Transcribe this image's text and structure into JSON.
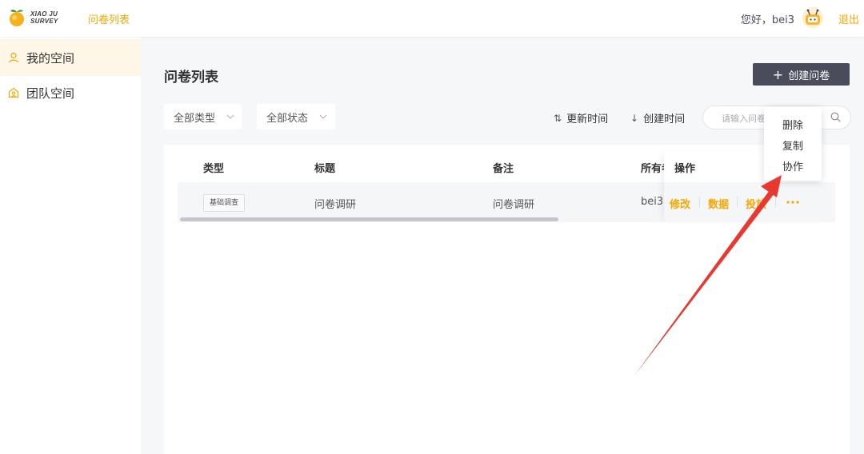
{
  "header": {
    "logo_line1": "XIAO JU",
    "logo_line2": "SURVEY",
    "nav_title": "问卷列表",
    "greeting": "您好，bei3",
    "logout": "退出"
  },
  "sidebar": {
    "items": [
      {
        "label": "我的空间",
        "icon": "user-icon",
        "active": true
      },
      {
        "label": "团队空间",
        "icon": "team-icon",
        "active": false
      }
    ]
  },
  "main": {
    "title": "问卷列表",
    "create_label": "创建问卷",
    "filters": {
      "type": "全部类型",
      "status": "全部状态"
    },
    "sorts": {
      "updated": "更新时间",
      "created": "创建时间"
    },
    "search": {
      "placeholder": "请输入问卷"
    },
    "table": {
      "headers": {
        "type": "类型",
        "title": "标题",
        "remark": "备注",
        "owner": "所有者",
        "actions": "操作"
      },
      "rows": [
        {
          "type": "基础调查",
          "title": "问卷调研",
          "remark": "问卷调研",
          "owner": "bei3"
        }
      ],
      "actions": {
        "edit": "修改",
        "data": "数据",
        "deliver": "投放"
      }
    },
    "dropdown": {
      "delete": "删除",
      "copy": "复制",
      "collab": "协作"
    }
  },
  "colors": {
    "accent": "#faa600",
    "dark_button": "#4a4c5b",
    "annotation_arrow": "#e8382f"
  }
}
